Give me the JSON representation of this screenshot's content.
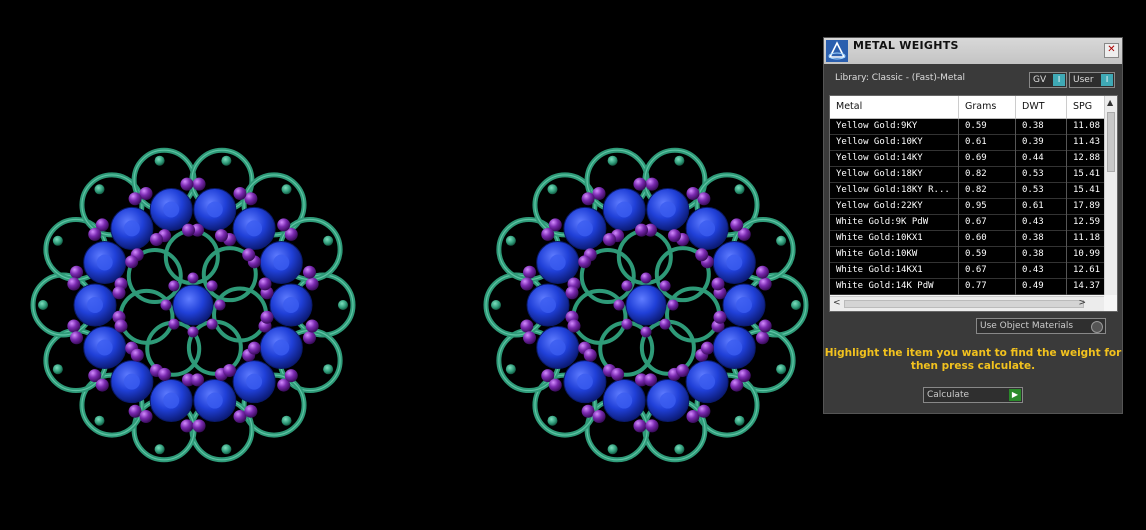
{
  "panel": {
    "title": "METAL WEIGHTS",
    "library_label": "Library: Classic - (Fast)-Metal",
    "toggle_gv": "GV",
    "toggle_user": "User",
    "columns": [
      "Metal",
      "Grams",
      "DWT",
      "SPG"
    ],
    "rows": [
      [
        "Yellow Gold:9KY",
        "0.59",
        "0.38",
        "11.08"
      ],
      [
        "Yellow Gold:10KY",
        "0.61",
        "0.39",
        "11.43"
      ],
      [
        "Yellow Gold:14KY",
        "0.69",
        "0.44",
        "12.88"
      ],
      [
        "Yellow Gold:18KY",
        "0.82",
        "0.53",
        "15.41"
      ],
      [
        "Yellow Gold:18KY R...",
        "0.82",
        "0.53",
        "15.41"
      ],
      [
        "Yellow Gold:22KY",
        "0.95",
        "0.61",
        "17.89"
      ],
      [
        "White Gold:9K PdW",
        "0.67",
        "0.43",
        "12.59"
      ],
      [
        "White Gold:10KX1",
        "0.60",
        "0.38",
        "11.18"
      ],
      [
        "White Gold:10KW",
        "0.59",
        "0.38",
        "10.99"
      ],
      [
        "White Gold:14KX1",
        "0.67",
        "0.43",
        "12.61"
      ],
      [
        "White Gold:14K PdW",
        "0.77",
        "0.49",
        "14.37"
      ]
    ],
    "use_object_materials": "Use Object Materials",
    "hint": "Highlight the item you want to find the weight for then press calculate.",
    "calculate": "Calculate",
    "colors": {
      "hint": "#f2c21e",
      "toggle_accent": "#3fa9b5",
      "calc_accent": "#2a8a2a"
    }
  },
  "viewport": {
    "description_objects": [
      "earring-left",
      "earring-right"
    ],
    "colors": {
      "metal": "#2e9a78",
      "stone_blue": "#1f3fd0",
      "bead_purple": "#7a2ab0"
    }
  }
}
